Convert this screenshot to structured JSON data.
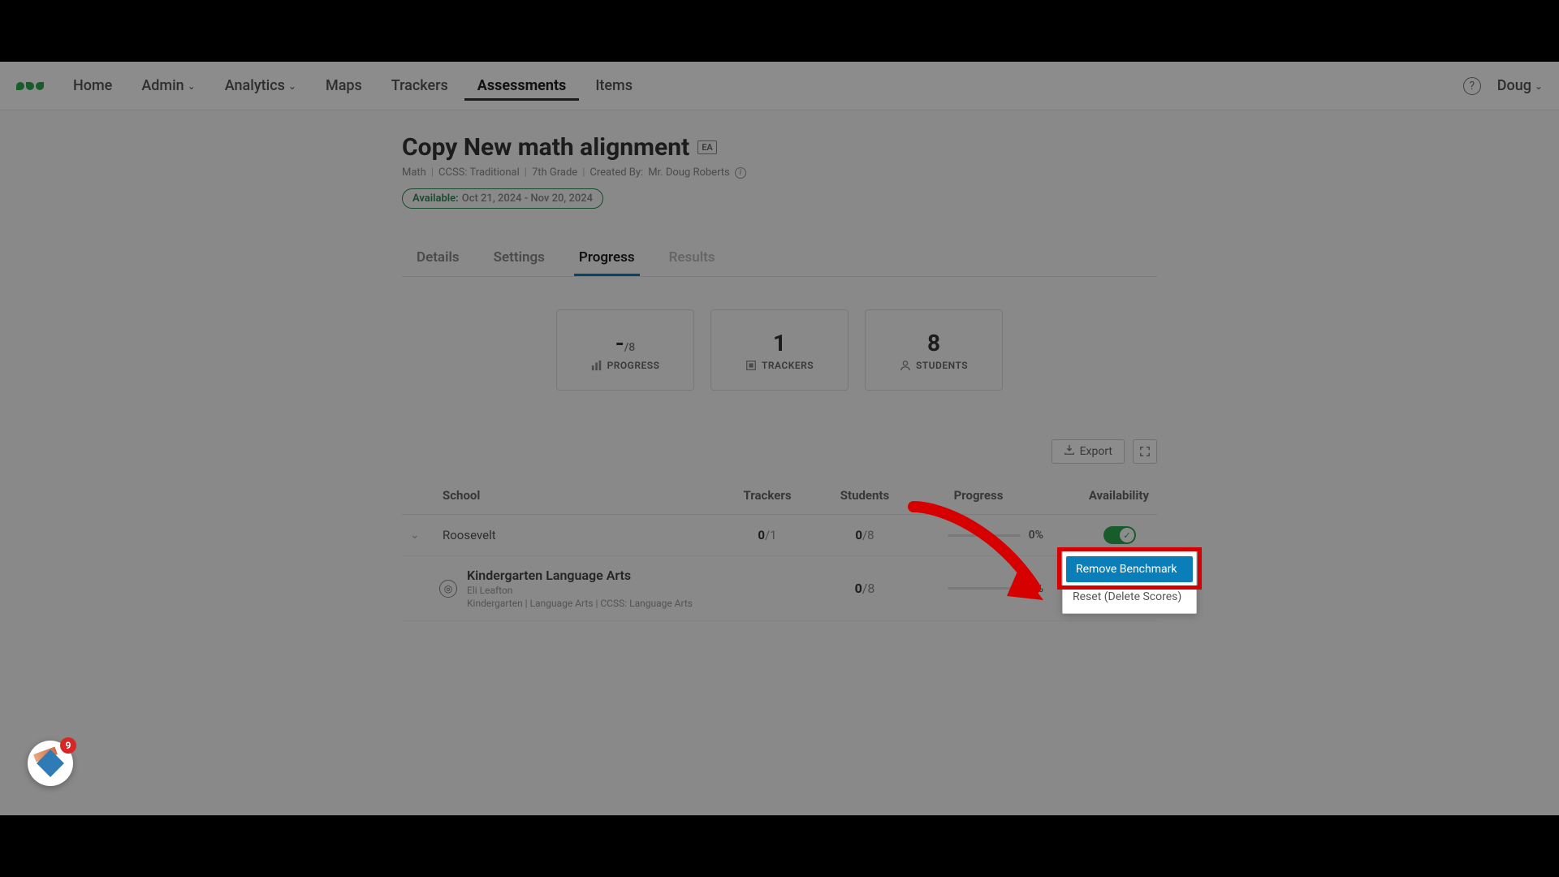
{
  "nav": {
    "items": [
      "Home",
      "Admin",
      "Analytics",
      "Maps",
      "Trackers",
      "Assessments",
      "Items"
    ],
    "active": "Assessments",
    "user": "Doug"
  },
  "page": {
    "title": "Copy New math alignment",
    "badge": "EA",
    "crumbs": {
      "subject": "Math",
      "standard": "CCSS: Traditional",
      "grade": "7th Grade",
      "created_by_label": "Created By:",
      "created_by_value": "Mr. Doug Roberts"
    },
    "availability": {
      "label": "Available:",
      "dates": "Oct 21, 2024 - Nov 20, 2024"
    }
  },
  "tabs": {
    "details": "Details",
    "settings": "Settings",
    "progress": "Progress",
    "results": "Results"
  },
  "stats": {
    "progress": {
      "value": "-",
      "denom": "/8",
      "label": "PROGRESS"
    },
    "trackers": {
      "value": "1",
      "label": "TRACKERS"
    },
    "students": {
      "value": "8",
      "label": "STUDENTS"
    }
  },
  "toolbar": {
    "export": "Export"
  },
  "table": {
    "headers": {
      "school": "School",
      "trackers": "Trackers",
      "students": "Students",
      "progress": "Progress",
      "availability": "Availability"
    },
    "row": {
      "school": "Roosevelt",
      "trackers_num": "0",
      "trackers_den": "/1",
      "students_num": "0",
      "students_den": "/8",
      "pct": "0%"
    },
    "subrow": {
      "title": "Kindergarten Language Arts",
      "teacher": "Eli Leafton",
      "meta": "Kindergarten  |  Language Arts  |  CCSS: Language Arts",
      "students_num": "0",
      "students_den": "/8",
      "pct": "0%"
    }
  },
  "dropdown": {
    "remove": "Remove Benchmark",
    "reset": "Reset (Delete Scores)"
  },
  "notif": {
    "count": "9"
  }
}
